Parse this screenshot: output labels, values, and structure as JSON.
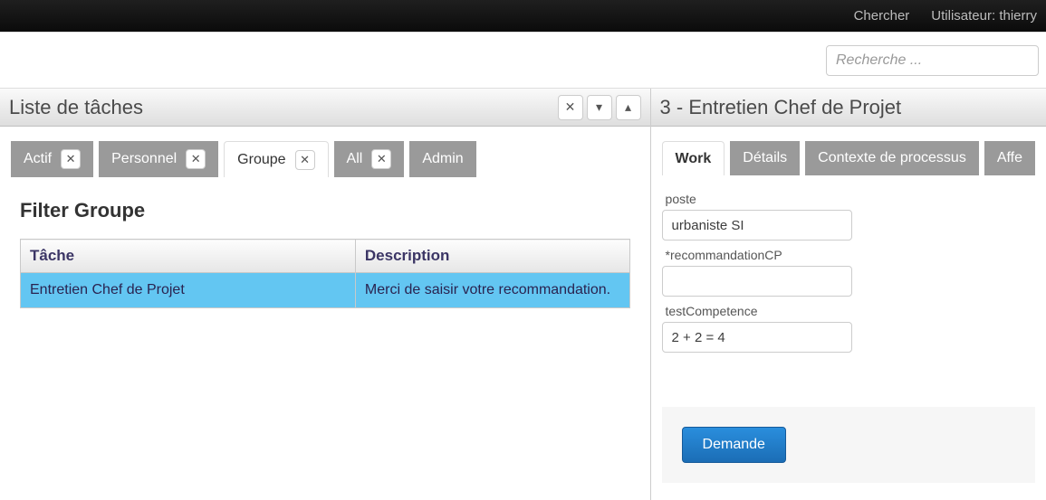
{
  "topbar": {
    "search_link": "Chercher",
    "user_label": "Utilisateur: thierry"
  },
  "search": {
    "placeholder": "Recherche ..."
  },
  "left_panel": {
    "title": "Liste de tâches",
    "header_buttons": {
      "close": "✕",
      "down": "▾",
      "up": "▴"
    },
    "tabs": [
      {
        "label": "Actif",
        "closable": true,
        "active": false
      },
      {
        "label": "Personnel",
        "closable": true,
        "active": false
      },
      {
        "label": "Groupe",
        "closable": true,
        "active": true
      },
      {
        "label": "All",
        "closable": true,
        "active": false
      },
      {
        "label": "Admin",
        "closable": false,
        "active": false
      }
    ],
    "filter_title": "Filter Groupe",
    "table": {
      "headers": {
        "task": "Tâche",
        "description": "Description"
      },
      "rows": [
        {
          "task": "Entretien Chef de Projet",
          "description": "Merci de saisir votre recommandation.",
          "selected": true
        }
      ]
    }
  },
  "right_panel": {
    "title": "3 - Entretien Chef de Projet",
    "tabs": [
      {
        "label": "Work",
        "active": true
      },
      {
        "label": "Détails",
        "active": false
      },
      {
        "label": "Contexte de processus",
        "active": false
      },
      {
        "label": "Affe",
        "active": false
      }
    ],
    "form": {
      "poste_label": "poste",
      "poste_value": "urbaniste SI",
      "recommandation_label": "*recommandationCP",
      "recommandation_value": "",
      "testcompetence_label": "testCompetence",
      "testcompetence_value": "2 + 2 = 4",
      "submit_label": "Demande"
    }
  }
}
